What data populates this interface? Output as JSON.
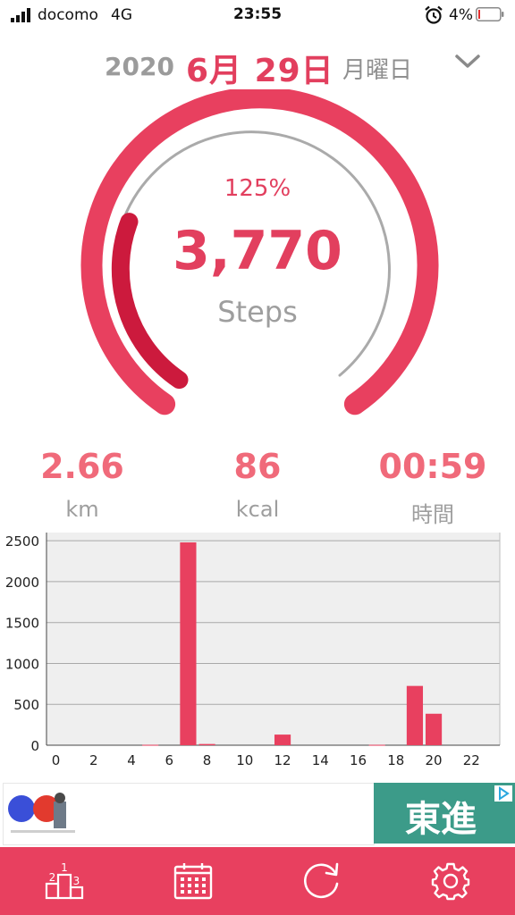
{
  "status_bar": {
    "carrier": "docomo",
    "network": "4G",
    "time": "23:55",
    "battery": "4%"
  },
  "date_header": {
    "year": "2020",
    "month_day": "6月 29日",
    "weekday": "月曜日"
  },
  "gauge": {
    "percent": "125%",
    "percent_value": 1.25,
    "steps": "3,770",
    "steps_label": "Steps"
  },
  "stats": {
    "distance": {
      "value": "2.66",
      "unit": "km"
    },
    "calories": {
      "value": "86",
      "unit": "kcal"
    },
    "duration": {
      "value": "00:59",
      "unit": "時間"
    }
  },
  "chart_data": {
    "type": "bar",
    "x": [
      0,
      1,
      2,
      3,
      4,
      5,
      6,
      7,
      8,
      9,
      10,
      11,
      12,
      13,
      14,
      15,
      16,
      17,
      18,
      19,
      20,
      21,
      22,
      23
    ],
    "values": [
      0,
      0,
      0,
      0,
      0,
      5,
      0,
      2480,
      15,
      0,
      0,
      0,
      130,
      0,
      0,
      0,
      0,
      5,
      0,
      725,
      385,
      0,
      0,
      0
    ],
    "x_ticks": [
      "0",
      "2",
      "4",
      "6",
      "8",
      "10",
      "12",
      "14",
      "16",
      "18",
      "20",
      "22"
    ],
    "y_ticks": [
      "0",
      "500",
      "1000",
      "1500",
      "2000",
      "2500"
    ],
    "ylim": [
      0,
      2600
    ],
    "xlim": [
      -0.5,
      23.5
    ],
    "grid": true,
    "bar_color": "#e8405f",
    "background": "#efefef"
  },
  "ad": {
    "brand_text": "東進"
  },
  "tab_bar": {
    "background": "#e8405f",
    "items": [
      "ranking-icon",
      "calendar-icon",
      "refresh-icon",
      "gear-icon"
    ]
  }
}
